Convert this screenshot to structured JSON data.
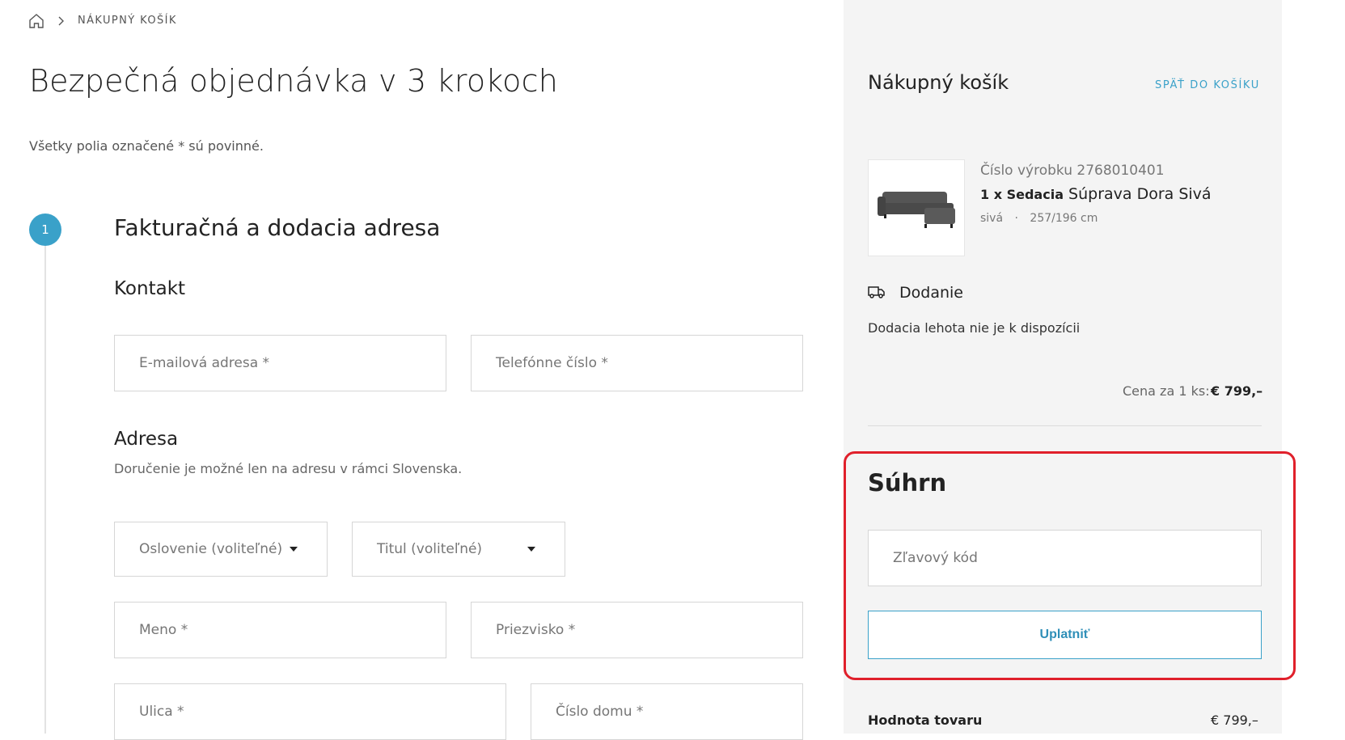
{
  "breadcrumb": {
    "home_icon": "home-icon",
    "separator_icon": "chevron-right-icon",
    "current": "NÁKUPNÝ KOŠÍK"
  },
  "page": {
    "title": "Bezpečná objednávka v 3 krokoch",
    "required_note": "Všetky polia označené * sú povinné."
  },
  "step": {
    "number": "1",
    "title": "Fakturačná a dodacia adresa"
  },
  "contact": {
    "title": "Kontakt",
    "email_placeholder": "E-mailová adresa *",
    "phone_placeholder": "Telefónne číslo *"
  },
  "address": {
    "title": "Adresa",
    "subtitle": "Doručenie je možné len na adresu v rámci Slovenska.",
    "salutation_label": "Oslovenie (voliteľné)",
    "title_select_label": "Titul (voliteľné)",
    "first_name_placeholder": "Meno *",
    "last_name_placeholder": "Priezvisko *",
    "street_placeholder": "Ulica *",
    "house_number_placeholder": "Číslo domu *"
  },
  "cart": {
    "title": "Nákupný košík",
    "back_link": "SPÄŤ DO KOŠÍKU",
    "product": {
      "number": "Číslo výrobku 2768010401",
      "qty_category": "1 x Sedacia",
      "name": "Súprava Dora Sivá",
      "color": "sivá",
      "separator": "·",
      "size": "257/196 cm"
    },
    "delivery": {
      "icon": "truck-icon",
      "title": "Dodanie",
      "text": "Dodacia lehota nie je k dispozícii"
    },
    "unit_price_label": "Cena za 1 ks:",
    "unit_price": "€ 799,–"
  },
  "summary": {
    "title": "Súhrn",
    "promo_placeholder": "Zľavový kód",
    "apply_label": "Uplatniť",
    "goods_value_label": "Hodnota tovaru",
    "goods_value": "€ 799,–"
  },
  "colors": {
    "accent": "#3aa1c9",
    "highlight": "#e0202b",
    "side_bg": "#f4f4f4"
  }
}
